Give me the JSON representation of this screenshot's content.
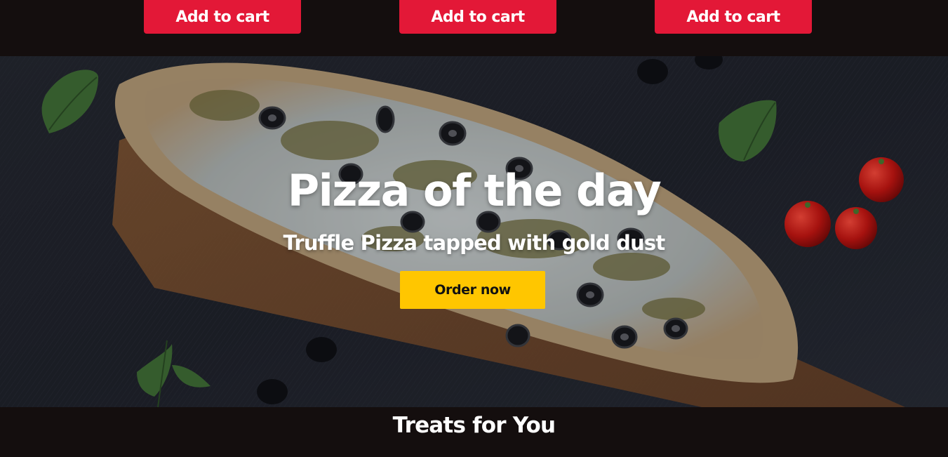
{
  "products": {
    "buttons": [
      {
        "label": "Add to cart"
      },
      {
        "label": "Add to cart"
      },
      {
        "label": "Add to cart"
      }
    ]
  },
  "hero": {
    "title": "Pizza of the day",
    "subtitle": "Truffle Pizza tapped with gold dust",
    "cta_label": "Order now",
    "image_icon": "pizza-photo"
  },
  "treats": {
    "title": "Treats for You"
  },
  "colors": {
    "cart_button": "#e31837",
    "cta_button": "#ffc600",
    "page_background": "#140e0e"
  }
}
